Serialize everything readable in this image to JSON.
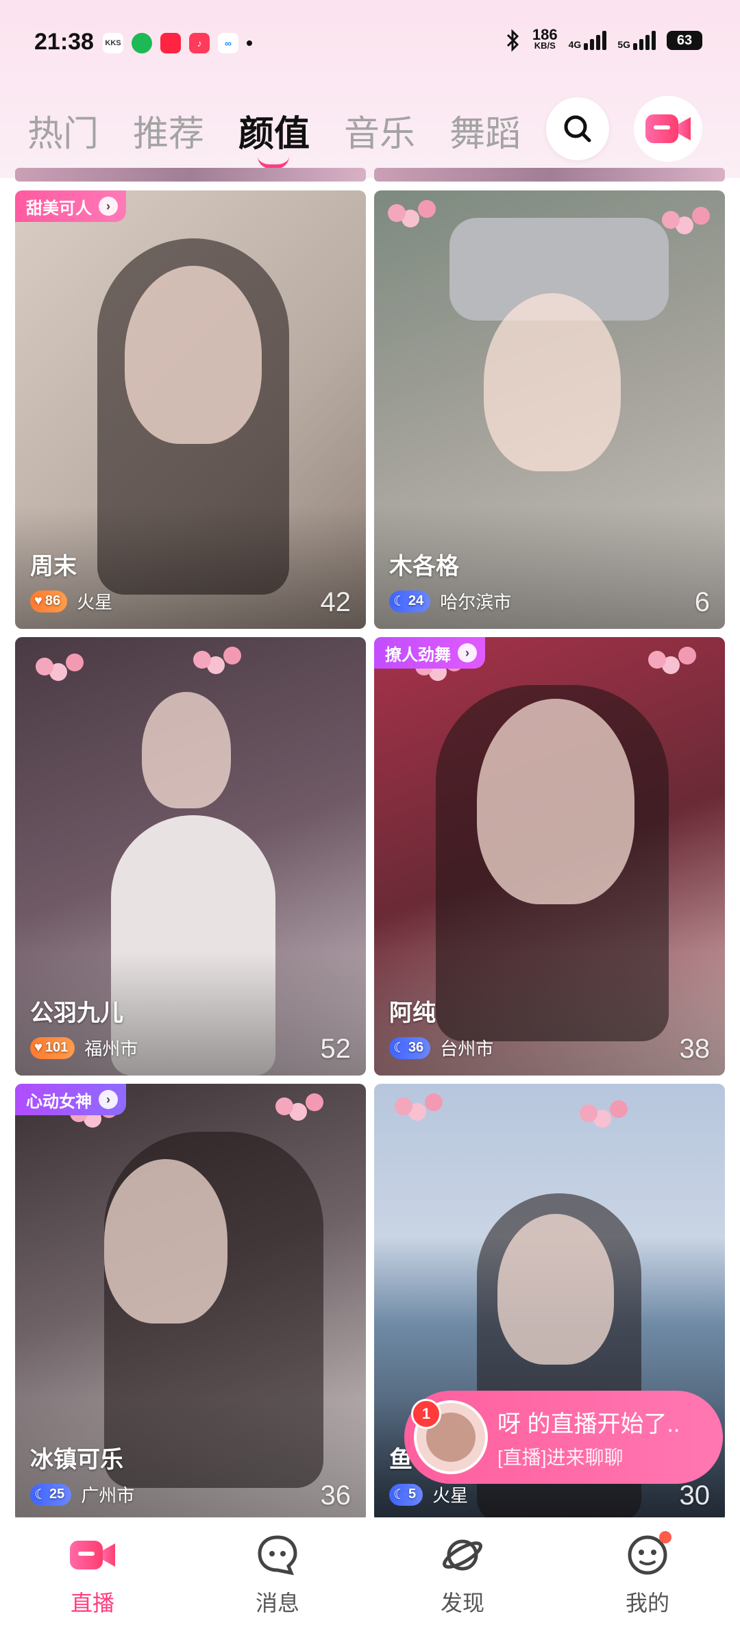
{
  "status_bar": {
    "time": "21:38",
    "speed_value": "186",
    "speed_unit": "KB/S",
    "net_4g": "4G",
    "net_5g": "5G",
    "battery": "63",
    "mini_apps": [
      "KKS",
      "spotify",
      "小红书",
      "music",
      "weibo"
    ]
  },
  "tabs": [
    {
      "label": "热门",
      "active": false
    },
    {
      "label": "推荐",
      "active": false
    },
    {
      "label": "颜值",
      "active": true
    },
    {
      "label": "音乐",
      "active": false
    },
    {
      "label": "舞蹈",
      "active": false
    }
  ],
  "cards": [
    {
      "badge": "甜美可人",
      "name": "周末",
      "level": "86",
      "location": "火星",
      "count": "42"
    },
    {
      "badge": "",
      "name": "木各格",
      "level": "24",
      "location": "哈尔滨市",
      "count": "6"
    },
    {
      "badge": "",
      "name": "公羽九儿",
      "level": "101",
      "location": "福州市",
      "count": "52"
    },
    {
      "badge": "撩人劲舞",
      "name": "阿纯",
      "level": "36",
      "location": "台州市",
      "count": "38"
    },
    {
      "badge": "心动女神",
      "name": "冰镇可乐",
      "level": "25",
      "location": "广州市",
      "count": "36"
    },
    {
      "badge": "",
      "name": "鱼",
      "level": "5",
      "location": "火星",
      "count": "30"
    }
  ],
  "toast": {
    "badge_count": "1",
    "title": "呀 的直播开始了..",
    "subtitle": "[直播]进来聊聊"
  },
  "bottom_nav": [
    {
      "label": "直播",
      "icon": "live-camera-icon",
      "active": true
    },
    {
      "label": "消息",
      "icon": "chat-bubble-icon",
      "active": false
    },
    {
      "label": "发现",
      "icon": "planet-icon",
      "active": false
    },
    {
      "label": "我的",
      "icon": "face-icon",
      "active": false
    }
  ],
  "colors": {
    "accent": "#ff3d7f",
    "badge_pink": "#ff5aa0",
    "badge_purple": "#c24dff"
  }
}
